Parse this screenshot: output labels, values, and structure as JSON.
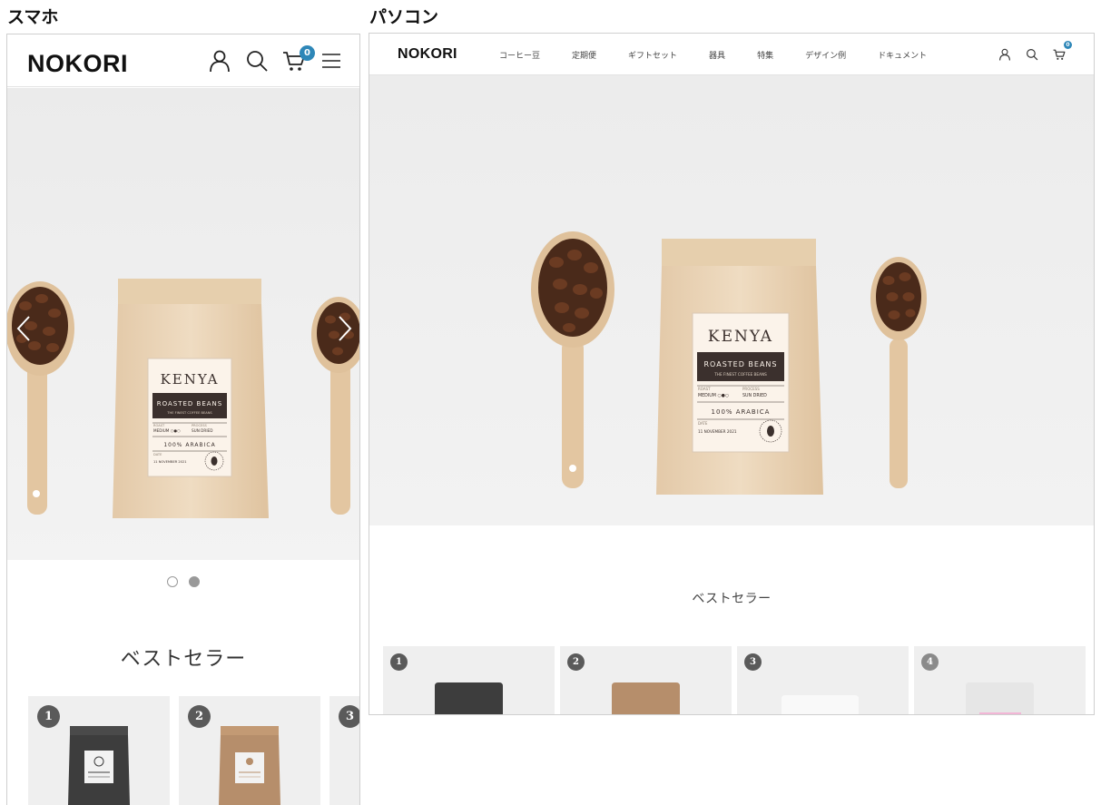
{
  "labels": {
    "smartphone": "スマホ",
    "pc": "パソコン"
  },
  "brand": "NOKORI",
  "cart_count": "0",
  "nav": [
    "コーヒー豆",
    "定期便",
    "ギフトセット",
    "器具",
    "特集",
    "デザイン例",
    "ドキュメント"
  ],
  "hero": {
    "bag_label_title": "KENYA",
    "bag_label_band": "ROASTED BEANS",
    "bag_label_band_sub": "THE FINEST COFFEE BEANS",
    "bag_roast_key": "ROAST",
    "bag_roast_value": "MEDIUM ○●○",
    "bag_process_key": "PROCESS",
    "bag_process_value": "SUN DRIED",
    "bag_origin": "100% ARABICA",
    "bag_date_key": "DATE",
    "bag_date_value": "11 NOVEMBER 2021"
  },
  "slider": {
    "total_slides": 2,
    "active_index": 2
  },
  "section_title": "ベストセラー",
  "products": [
    {
      "rank": "1",
      "bag_color": "#3d3d3d"
    },
    {
      "rank": "2",
      "bag_color": "#b68e6b"
    },
    {
      "rank": "3",
      "bag_color": "#f7f7f7"
    },
    {
      "rank": "4",
      "bag_color": "#e6e6e6"
    }
  ],
  "colors": {
    "accent": "#2e87b8",
    "rank_badge_dark": "#5a5a5a",
    "rank_badge_light": "#8a8a8a",
    "hero_bg": "#eeeeee",
    "bag": "#e9d3b4",
    "wood": "#e6c9a5",
    "label_bg": "#fbf3ea",
    "label_band": "#3b302d"
  }
}
